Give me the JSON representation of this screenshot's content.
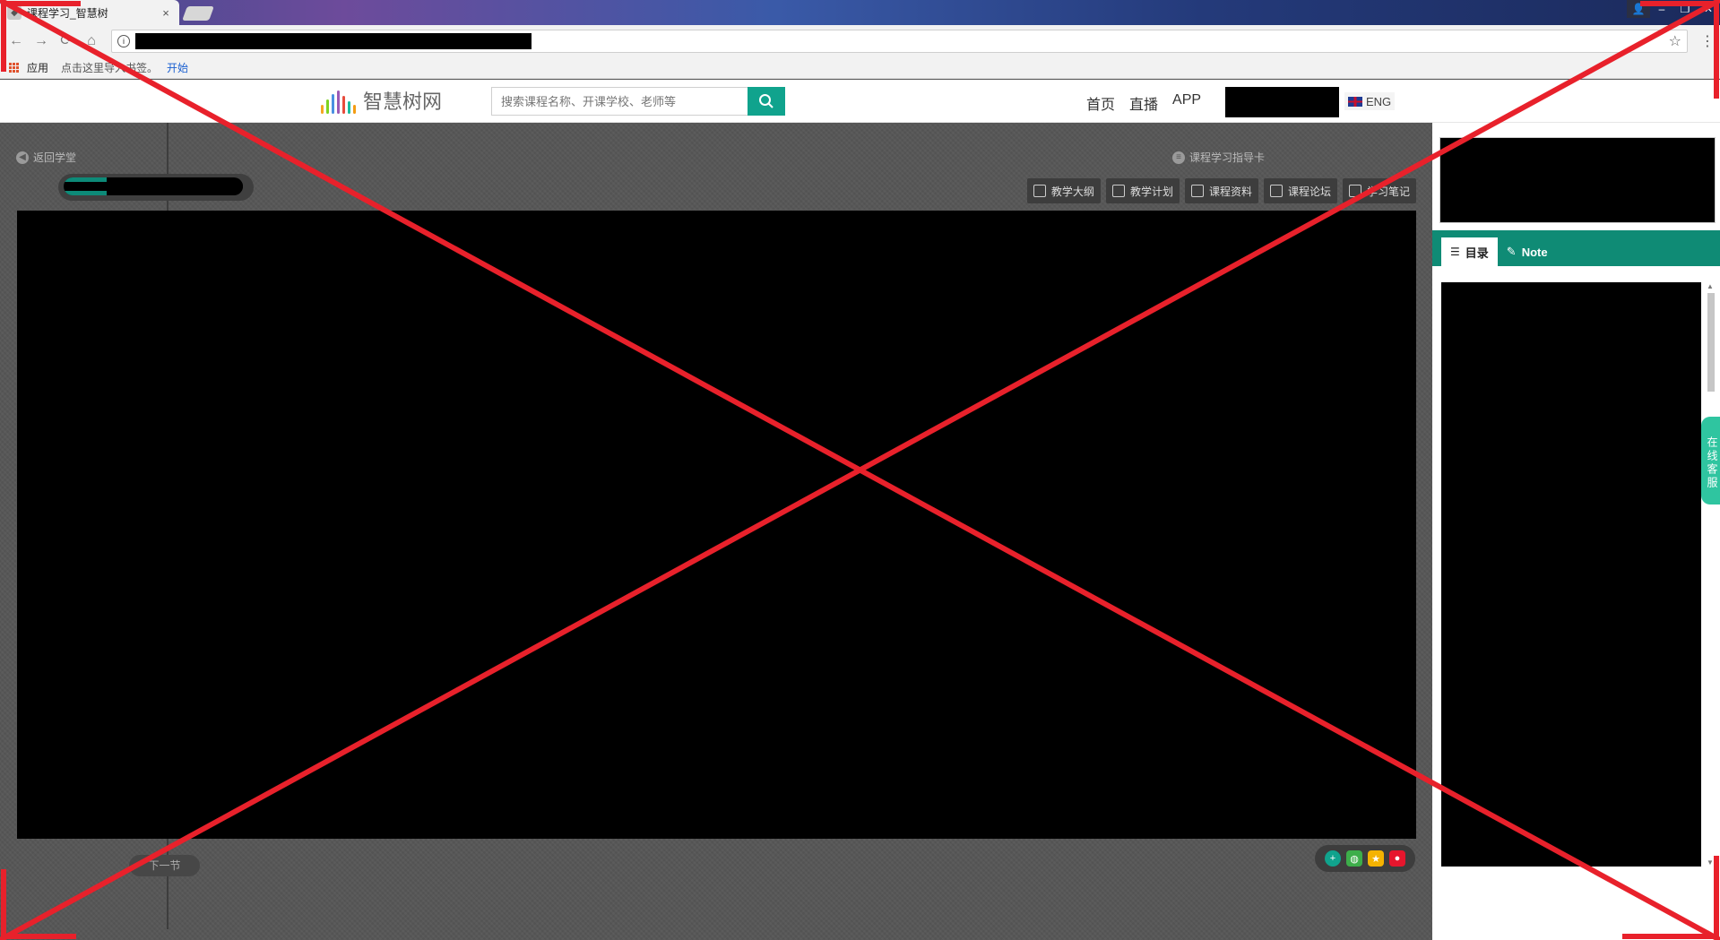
{
  "browser": {
    "tab_title": "课程学习_智慧树",
    "tab_close": "×",
    "window_controls": {
      "profile": "👤",
      "minimize": "–",
      "maximize": "❐",
      "close": "✕"
    },
    "nav": {
      "back": "←",
      "forward": "→",
      "reload": "⟳",
      "home": "⌂"
    },
    "omnibox_info": "i",
    "bookmark_star": "☆",
    "menu": "⋮",
    "bookmarks": {
      "apps": "应用",
      "hint": "点击这里导入书签。",
      "start": "开始"
    }
  },
  "header": {
    "logo_text": "智慧树网",
    "search_placeholder": "搜索课程名称、开课学校、老师等",
    "nav": [
      "首页",
      "直播",
      "APP"
    ],
    "lang": "ENG"
  },
  "course": {
    "back_label": "返回学堂",
    "guide_label": "课程学习指导卡",
    "progress": 0.24,
    "toolbar": [
      "教学大纲",
      "教学计划",
      "课程资料",
      "课程论坛",
      "学习笔记"
    ],
    "next_label": "下一节"
  },
  "sidepanel": {
    "tabs": [
      "目录",
      "Note"
    ],
    "service_label": "在线客服"
  },
  "colors": {
    "accent": "#10a38d",
    "panel_tab": "#0f8b75",
    "service": "#2fc5a0",
    "overlay": "#e8212b"
  }
}
